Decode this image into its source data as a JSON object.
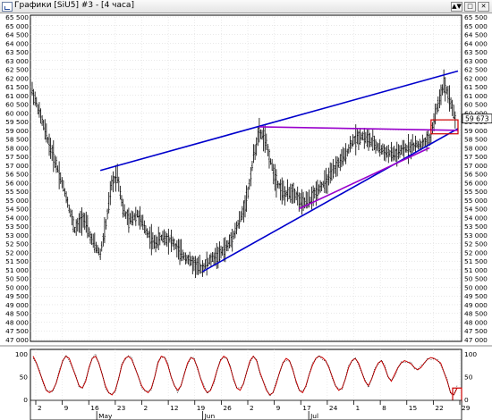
{
  "window": {
    "title": "Графики [SiU5] #3 - [4 часа]",
    "buttons": [
      "▲▼",
      "□",
      "✕"
    ]
  },
  "price_axis": {
    "labels": [
      "65 500",
      "65 000",
      "64 500",
      "64 000",
      "63 500",
      "63 000",
      "62 500",
      "62 000",
      "61 500",
      "61 000",
      "60 500",
      "60 000",
      "59 500",
      "59 000",
      "58 500",
      "58 000",
      "57 500",
      "57 000",
      "56 500",
      "56 000",
      "55 500",
      "55 000",
      "54 500",
      "54 000",
      "53 500",
      "53 000",
      "52 500",
      "52 000",
      "51 500",
      "51 000",
      "50 500",
      "50 000",
      "49 500",
      "49 000",
      "48 500",
      "48 000",
      "47 500",
      "47 000"
    ],
    "current": "59 673",
    "ylim": [
      47000,
      65500
    ]
  },
  "osc_axis": {
    "labels": [
      "100",
      "50",
      "0"
    ],
    "ylim": [
      0,
      100
    ]
  },
  "time_axis": {
    "days": [
      "2",
      "9",
      "16",
      "23",
      "2",
      "12",
      "19",
      "26",
      "2",
      "9",
      "17",
      "24",
      "1",
      "8",
      "15",
      "22",
      "29"
    ],
    "months": [
      "May",
      "Jun",
      "Jul"
    ]
  },
  "chart_data": {
    "type": "candlestick",
    "instrument": "SiU5",
    "timeframe": "4 часа",
    "title": "Графики [SiU5] #3 - [4 часа]",
    "ylim": [
      47000,
      65500
    ],
    "price_path": [
      [
        0,
        61300
      ],
      [
        6,
        59800
      ],
      [
        12,
        58200
      ],
      [
        18,
        56800
      ],
      [
        24,
        55200
      ],
      [
        30,
        53300
      ],
      [
        36,
        54000
      ],
      [
        42,
        52700
      ],
      [
        48,
        51900
      ],
      [
        52,
        53600
      ],
      [
        56,
        55900
      ],
      [
        60,
        56500
      ],
      [
        64,
        54500
      ],
      [
        68,
        53800
      ],
      [
        74,
        54200
      ],
      [
        80,
        53300
      ],
      [
        86,
        52500
      ],
      [
        92,
        52900
      ],
      [
        98,
        52700
      ],
      [
        104,
        52000
      ],
      [
        110,
        51600
      ],
      [
        116,
        51200
      ],
      [
        120,
        51100
      ],
      [
        126,
        51600
      ],
      [
        132,
        51900
      ],
      [
        138,
        52400
      ],
      [
        144,
        53400
      ],
      [
        148,
        54200
      ],
      [
        152,
        55400
      ],
      [
        156,
        57500
      ],
      [
        160,
        58900
      ],
      [
        164,
        58500
      ],
      [
        168,
        57200
      ],
      [
        172,
        56100
      ],
      [
        178,
        55300
      ],
      [
        184,
        55500
      ],
      [
        190,
        54800
      ],
      [
        196,
        55000
      ],
      [
        202,
        55700
      ],
      [
        208,
        56100
      ],
      [
        214,
        56900
      ],
      [
        220,
        57500
      ],
      [
        226,
        58400
      ],
      [
        232,
        58700
      ],
      [
        238,
        58400
      ],
      [
        244,
        58000
      ],
      [
        250,
        57700
      ],
      [
        256,
        57600
      ],
      [
        262,
        57900
      ],
      [
        268,
        58100
      ],
      [
        274,
        58200
      ],
      [
        280,
        58500
      ],
      [
        286,
        60500
      ],
      [
        290,
        61700
      ],
      [
        294,
        60900
      ],
      [
        298,
        59673
      ]
    ],
    "oscillator": {
      "ylim": [
        0,
        100
      ],
      "values": [
        95,
        80,
        60,
        40,
        20,
        15,
        20,
        35,
        60,
        85,
        95,
        90,
        70,
        50,
        30,
        25,
        40,
        70,
        90,
        95,
        80,
        55,
        30,
        15,
        10,
        20,
        45,
        75,
        90,
        95,
        88,
        70,
        50,
        30,
        20,
        15,
        25,
        50,
        80,
        95,
        92,
        75,
        50,
        30,
        20,
        30,
        55,
        80,
        92,
        88,
        70,
        45,
        25,
        15,
        20,
        40,
        65,
        85,
        95,
        90,
        70,
        45,
        25,
        20,
        35,
        60,
        85,
        95,
        85,
        60,
        40,
        20,
        10,
        15,
        35,
        60,
        80,
        90,
        85,
        65,
        40,
        20,
        15,
        30,
        55,
        75,
        90,
        95,
        92,
        85,
        70,
        50,
        30,
        20,
        25,
        45,
        70,
        85,
        90,
        80,
        60,
        40,
        30,
        45,
        65,
        80,
        85,
        70,
        50,
        40,
        55,
        70,
        80,
        85,
        82,
        78,
        70,
        65,
        70,
        80,
        88,
        92,
        90,
        85,
        80,
        60,
        40,
        15,
        10,
        25
      ]
    },
    "annotations": [
      {
        "type": "trendline",
        "color": "#0000cc",
        "from": [
          48,
          56700
        ],
        "to": [
          300,
          62400
        ]
      },
      {
        "type": "trendline",
        "color": "#0000cc",
        "from": [
          120,
          50900
        ],
        "to": [
          300,
          59100
        ]
      },
      {
        "type": "trendline",
        "color": "#9900cc",
        "from": [
          160,
          59200
        ],
        "to": [
          300,
          59000
        ]
      },
      {
        "type": "trendline",
        "color": "#9900cc",
        "from": [
          188,
          54500
        ],
        "to": [
          280,
          58000
        ]
      },
      {
        "type": "rect",
        "color": "#cc0000",
        "x_range": [
          281,
          300
        ],
        "y_range": [
          58800,
          59600
        ]
      },
      {
        "type": "rect",
        "color": "#cc0000",
        "x_range": [
          290,
          300
        ],
        "osc_range": [
          0,
          25
        ]
      }
    ]
  }
}
